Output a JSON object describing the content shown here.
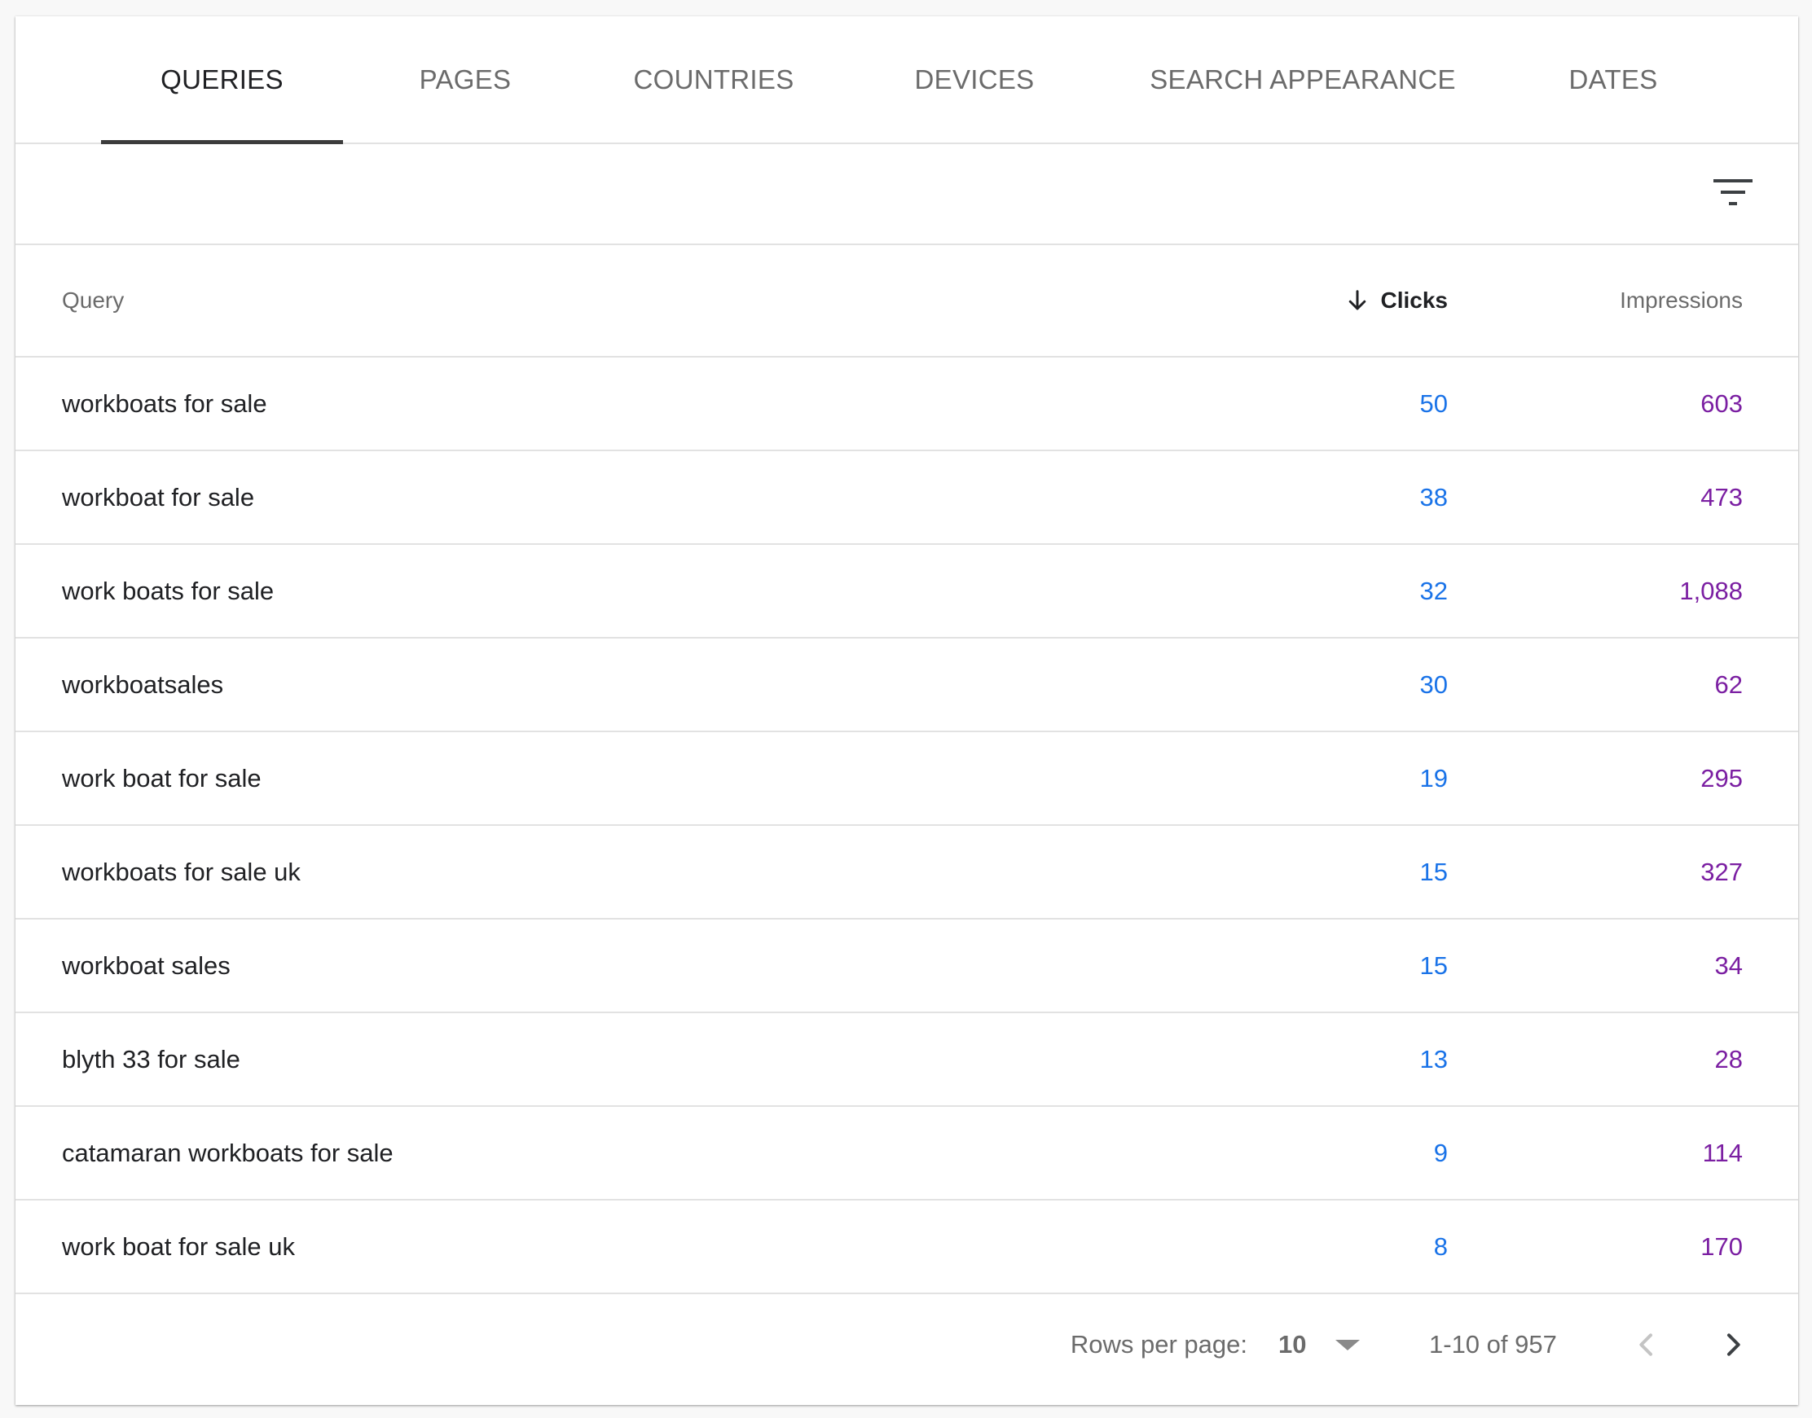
{
  "tabs": [
    {
      "label": "QUERIES",
      "active": true
    },
    {
      "label": "PAGES",
      "active": false
    },
    {
      "label": "COUNTRIES",
      "active": false
    },
    {
      "label": "DEVICES",
      "active": false
    },
    {
      "label": "SEARCH APPEARANCE",
      "active": false
    },
    {
      "label": "DATES",
      "active": false
    }
  ],
  "filter": {
    "icon": "filter-list-icon"
  },
  "table": {
    "columns": {
      "query": "Query",
      "clicks": "Clicks",
      "impressions": "Impressions"
    },
    "sort": {
      "column": "clicks",
      "direction": "descending",
      "icon": "arrow-down-icon"
    },
    "rows": [
      {
        "query": "workboats for sale",
        "clicks": "50",
        "impressions": "603"
      },
      {
        "query": "workboat for sale",
        "clicks": "38",
        "impressions": "473"
      },
      {
        "query": "work boats for sale",
        "clicks": "32",
        "impressions": "1,088"
      },
      {
        "query": "workboatsales",
        "clicks": "30",
        "impressions": "62"
      },
      {
        "query": "work boat for sale",
        "clicks": "19",
        "impressions": "295"
      },
      {
        "query": "workboats for sale uk",
        "clicks": "15",
        "impressions": "327"
      },
      {
        "query": "workboat sales",
        "clicks": "15",
        "impressions": "34"
      },
      {
        "query": "blyth 33 for sale",
        "clicks": "13",
        "impressions": "28"
      },
      {
        "query": "catamaran workboats for sale",
        "clicks": "9",
        "impressions": "114"
      },
      {
        "query": "work boat for sale uk",
        "clicks": "8",
        "impressions": "170"
      }
    ]
  },
  "pagination": {
    "rows_per_page_label": "Rows per page:",
    "rows_per_page_value": "10",
    "range_label": "1-10 of 957"
  },
  "colors": {
    "clicks": "#1a73e8",
    "impressions": "#7b1fa2",
    "active_tab": "#202124",
    "inactive_tab": "#6b6b6b"
  }
}
